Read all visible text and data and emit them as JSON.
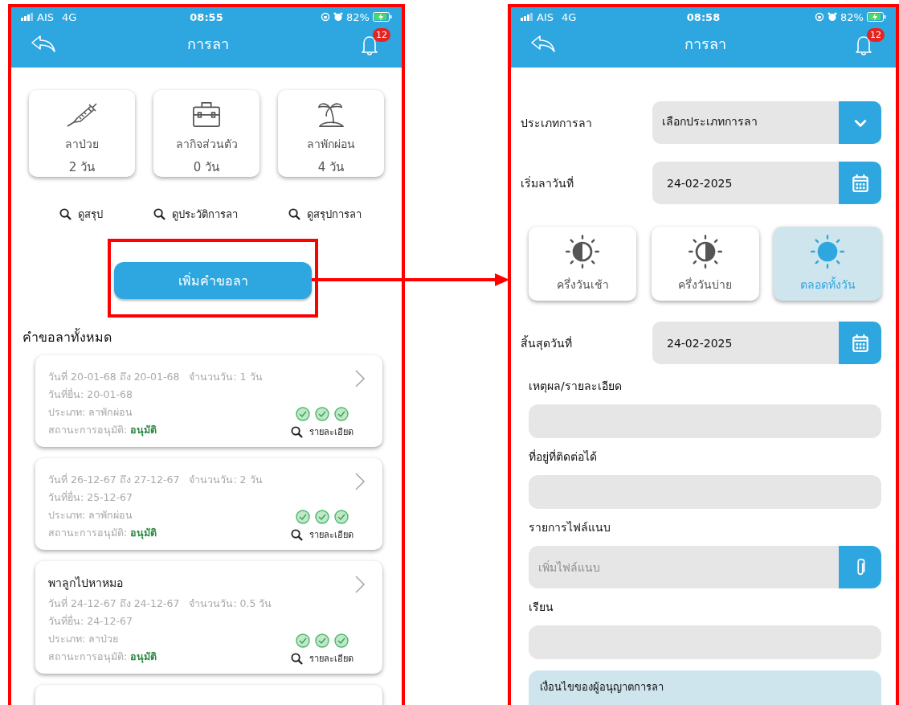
{
  "screens": [
    {
      "kind": "requests",
      "status_bar": {
        "carrier": "AIS",
        "network": "4G",
        "time": "08:55",
        "battery": "82%"
      },
      "header": {
        "title": "การลา",
        "badge": "12"
      },
      "balances": [
        {
          "kind": "sick",
          "label": "ลาป่วย",
          "value": "2 วัน"
        },
        {
          "kind": "personal",
          "label": "ลากิจส่วนตัว",
          "value": "0 วัน"
        },
        {
          "kind": "vacation",
          "label": "ลาพักผ่อน",
          "value": "4 วัน"
        }
      ],
      "links": [
        "ดูสรุป",
        "ดูประวัติการลา",
        "ดูสรุปการลา"
      ],
      "add_button": "เพิ่มคำขอลา",
      "section_title": "คำขอลาทั้งหมด",
      "requests": [
        {
          "dates": "วันที่ 20-01-68 ถึง 20-01-68",
          "days": "จำนวนวัน: 1 วัน",
          "submitted": "วันที่ยื่น: 20-01-68",
          "type": "ประเภท: ลาพักผ่อน",
          "status_label": "สถานะการอนุมัติ:",
          "status": "อนุมัติ",
          "approvals": [
            {
              "approved": true
            },
            {
              "approved": true
            },
            {
              "approved": true
            }
          ],
          "details": "รายละเอียด"
        },
        {
          "dates": "วันที่ 26-12-67 ถึง 27-12-67",
          "days": "จำนวนวัน: 2 วัน",
          "submitted": "วันที่ยื่น: 25-12-67",
          "type": "ประเภท: ลาพักผ่อน",
          "status_label": "สถานะการอนุมัติ:",
          "status": "อนุมัติ",
          "approvals": [
            {
              "approved": true
            },
            {
              "approved": true
            },
            {
              "approved": true
            }
          ],
          "details": "รายละเอียด"
        },
        {
          "title": "พาลูกไปหาหมอ",
          "dates": "วันที่ 24-12-67 ถึง 24-12-67",
          "days": "จำนวนวัน: 0.5 วัน",
          "submitted": "วันที่ยื่น: 24-12-67",
          "type": "ประเภท: ลาป่วย",
          "status_label": "สถานะการอนุมัติ:",
          "status": "อนุมัติ",
          "approvals": [
            {
              "approved": true
            },
            {
              "approved": true
            },
            {
              "approved": true
            }
          ],
          "details": "รายละเอียด"
        }
      ]
    },
    {
      "kind": "form",
      "status_bar": {
        "carrier": "AIS",
        "network": "4G",
        "time": "08:58",
        "battery": "82%"
      },
      "header": {
        "title": "การลา",
        "badge": "12"
      },
      "fields": [
        {
          "kind": "select",
          "label": "ประเภทการลา",
          "value": "เลือกประเภทการลา"
        },
        {
          "kind": "date",
          "label": "เริ่มลาวันที่",
          "value": "24-02-2025"
        },
        {
          "kind": "periods",
          "options": [
            {
              "kind": "morning",
              "label": "ครึ่งวันเช้า",
              "selected": false
            },
            {
              "kind": "afternoon",
              "label": "ครึ่งวันบ่าย",
              "selected": false
            },
            {
              "kind": "full",
              "label": "ตลอดทั้งวัน",
              "selected": true
            }
          ]
        },
        {
          "kind": "date",
          "label": "สิ้นสุดวันที่",
          "value": "24-02-2025"
        },
        {
          "kind": "text",
          "label": "เหตุผล/รายละเอียด"
        },
        {
          "kind": "text",
          "label": "ที่อยู่ที่ติดต่อได้"
        },
        {
          "kind": "file",
          "label": "รายการไฟล์แนบ",
          "placeholder": "เพิ่มไฟล์แนบ"
        },
        {
          "kind": "text",
          "label": "เรียน"
        },
        {
          "kind": "notice",
          "title": "เงื่อนไขของผู้อนุญาตการลา"
        }
      ]
    }
  ]
}
